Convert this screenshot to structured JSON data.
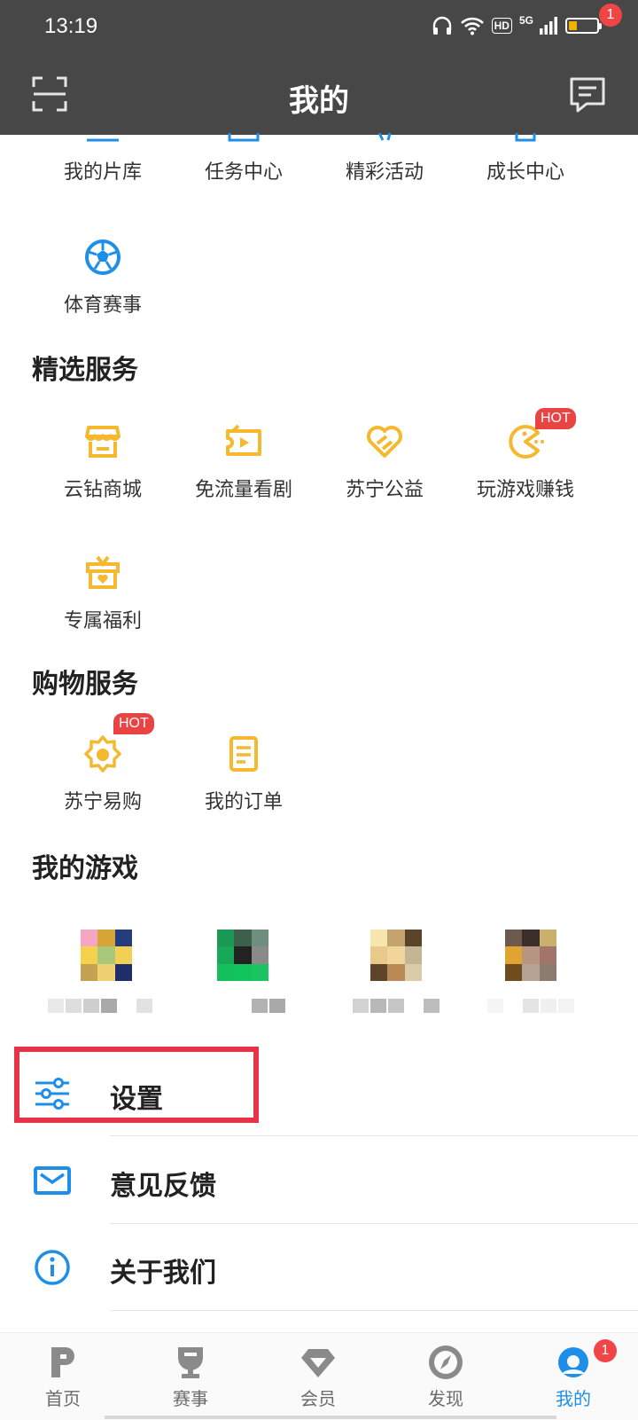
{
  "status": {
    "time": "13:19",
    "hd": "HD",
    "net": "5G"
  },
  "header": {
    "title": "我的",
    "message_badge": "1"
  },
  "quick_items": [
    {
      "label": "我的片库",
      "icon": "library-icon"
    },
    {
      "label": "任务中心",
      "icon": "task-icon"
    },
    {
      "label": "精彩活动",
      "icon": "activity-icon"
    },
    {
      "label": "成长中心",
      "icon": "growth-icon"
    },
    {
      "label": "体育赛事",
      "icon": "football-icon"
    }
  ],
  "featured": {
    "title": "精选服务",
    "items": [
      {
        "label": "云钻商城",
        "icon": "store-icon"
      },
      {
        "label": "免流量看剧",
        "icon": "ticket-video-icon"
      },
      {
        "label": "苏宁公益",
        "icon": "heart-charity-icon"
      },
      {
        "label": "玩游戏赚钱",
        "icon": "pacman-icon",
        "badge": "HOT"
      },
      {
        "label": "专属福利",
        "icon": "gift-icon"
      }
    ]
  },
  "shopping": {
    "title": "购物服务",
    "items": [
      {
        "label": "苏宁易购",
        "icon": "suning-icon",
        "badge": "HOT"
      },
      {
        "label": "我的订单",
        "icon": "order-icon"
      }
    ]
  },
  "games": {
    "title": "我的游戏"
  },
  "list": [
    {
      "label": "设置",
      "icon": "settings-icon"
    },
    {
      "label": "意见反馈",
      "icon": "mail-icon"
    },
    {
      "label": "关于我们",
      "icon": "info-icon"
    }
  ],
  "tabs": [
    {
      "label": "首页",
      "icon": "home-icon"
    },
    {
      "label": "赛事",
      "icon": "trophy-icon"
    },
    {
      "label": "会员",
      "icon": "diamond-icon"
    },
    {
      "label": "发现",
      "icon": "compass-icon"
    },
    {
      "label": "我的",
      "icon": "profile-icon",
      "active": true,
      "badge": "1"
    }
  ],
  "colors": {
    "header_bg": "#474747",
    "accent_blue": "#1e8fe8",
    "service_yellow": "#f5b82e",
    "hot_red": "#ea4343",
    "highlight_red": "#e73348"
  }
}
